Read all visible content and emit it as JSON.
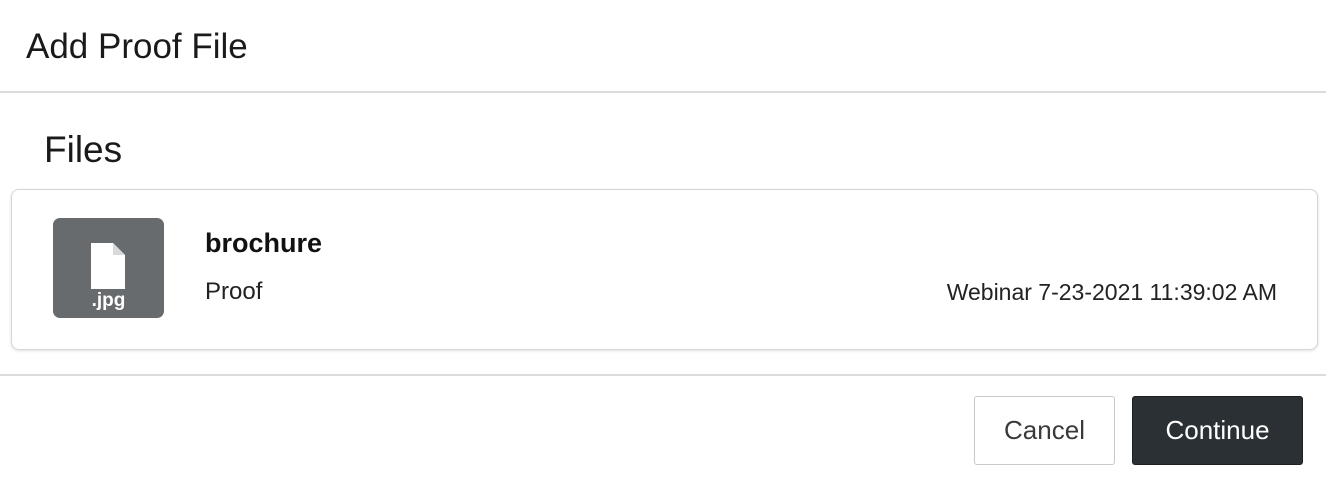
{
  "dialog": {
    "title": "Add Proof File"
  },
  "files_section": {
    "title": "Files",
    "items": [
      {
        "name": "brochure",
        "extension": ".jpg",
        "type": "Proof",
        "meta": "Webinar 7-23-2021 11:39:02 AM",
        "icon": "file-icon"
      }
    ]
  },
  "footer": {
    "cancel_label": "Cancel",
    "continue_label": "Continue"
  },
  "colors": {
    "thumb_bg": "#686b6e",
    "primary_button": "#2b3034"
  }
}
